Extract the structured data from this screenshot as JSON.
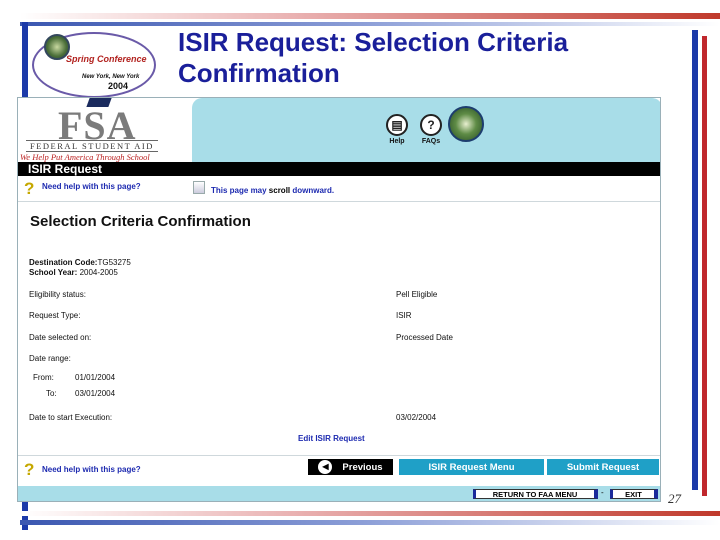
{
  "slide": {
    "title": "ISIR Request: Selection Criteria Confirmation",
    "page_number": "27",
    "logo": {
      "title": "Spring Conference",
      "city": "New York, New York",
      "year": "2004"
    }
  },
  "fsa": {
    "logo_text": "FSA",
    "federal": "FEDERAL STUDENT AID",
    "tagline": "We Help Put America Through School",
    "toolbar": {
      "help_label": "Help",
      "faqs_label": "FAQs"
    }
  },
  "page": {
    "heading_bar": "ISIR Request",
    "help_link": "Need help with this page?",
    "scroll_note_pre": "This page may ",
    "scroll_note_bold": "scroll",
    "scroll_note_post": " downward.",
    "section_title": "Selection Criteria Confirmation",
    "destination_label": "Destination Code:",
    "destination_value": "TG53275",
    "school_year_label": "School Year:",
    "school_year_value": "2004-2005",
    "rows": [
      {
        "label": "Eligibility status:",
        "value": "Pell Eligible"
      },
      {
        "label": "Request Type:",
        "value": "ISIR"
      },
      {
        "label": "Date selected on:",
        "value": "Processed Date"
      },
      {
        "label": "Date range:",
        "value": ""
      }
    ],
    "from_label": "From:",
    "from_value": "01/01/2004",
    "to_label": "To:",
    "to_value": "03/01/2004",
    "execution_label": "Date to start Execution:",
    "execution_value": "03/02/2004",
    "edit_link": "Edit ISIR Request",
    "help_link_bottom": "Need help with this page?",
    "buttons": {
      "previous": "Previous",
      "menu": "ISIR Request Menu",
      "submit": "Submit Request"
    },
    "footer": {
      "return": "RETURN TO FAA MENU",
      "separator": "-",
      "exit": "EXIT"
    }
  },
  "colors": {
    "title_blue": "#1a1f9a",
    "banner_teal": "#a8dde8",
    "button_teal": "#1fa0c7",
    "link_blue": "#1d2ab0"
  }
}
